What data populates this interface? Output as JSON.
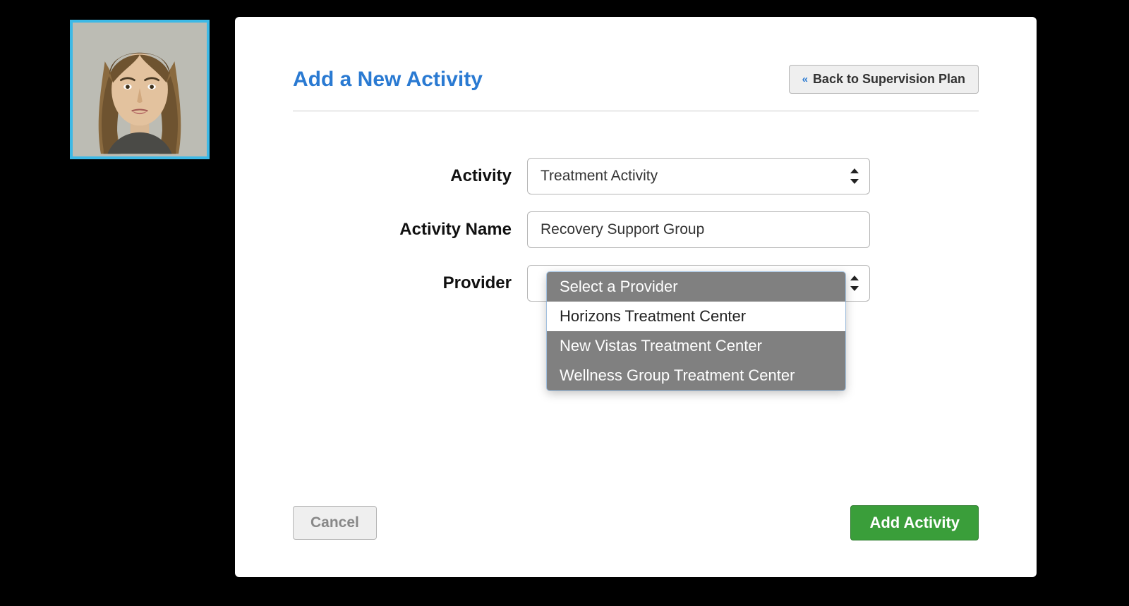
{
  "header": {
    "title": "Add a New Activity",
    "back_label": "Back to Supervision Plan"
  },
  "form": {
    "activity": {
      "label": "Activity",
      "value": "Treatment Activity"
    },
    "activity_name": {
      "label": "Activity Name",
      "value": "Recovery Support Group"
    },
    "provider": {
      "label": "Provider",
      "options": [
        "Select a Provider",
        "Horizons Treatment Center",
        "New Vistas Treatment Center",
        "Wellness Group Treatment Center"
      ],
      "highlighted_index": 1
    }
  },
  "footer": {
    "cancel_label": "Cancel",
    "submit_label": "Add Activity"
  }
}
